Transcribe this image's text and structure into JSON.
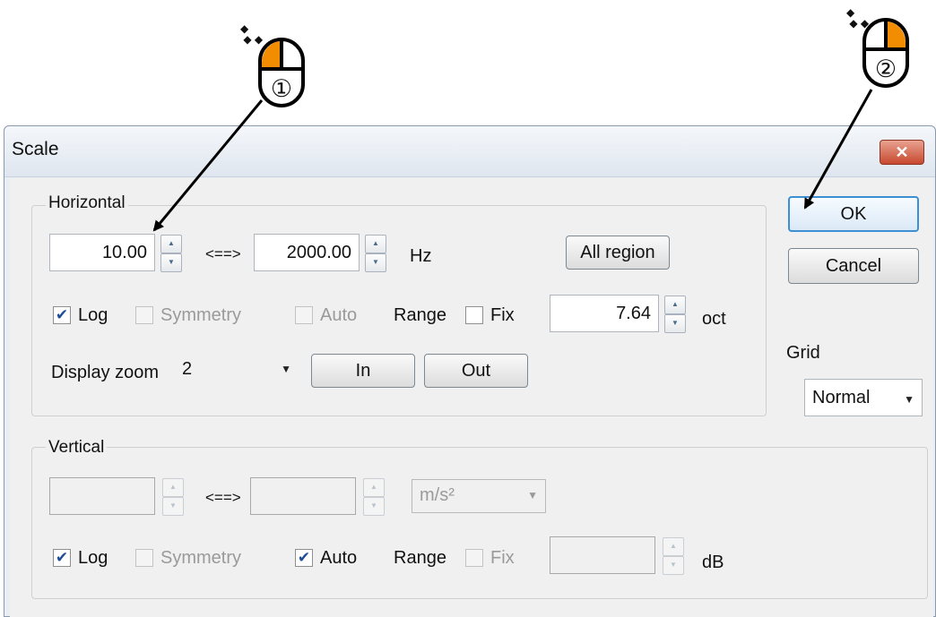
{
  "dialog": {
    "title": "Scale",
    "close_symbol": "✕"
  },
  "buttons": {
    "ok": "OK",
    "cancel": "Cancel"
  },
  "grid": {
    "label": "Grid",
    "value": "Normal"
  },
  "horizontal": {
    "label": "Horizontal",
    "from": "10.00",
    "between": "<==>",
    "to": "2000.00",
    "unit": "Hz",
    "all_region": "All region",
    "log_label": "Log",
    "log_checked": true,
    "symmetry_label": "Symmetry",
    "auto_label": "Auto",
    "range_label": "Range",
    "fix_label": "Fix",
    "range_value": "7.64",
    "range_unit": "oct",
    "zoom_label": "Display zoom",
    "zoom_value": "2",
    "in_label": "In",
    "out_label": "Out"
  },
  "vertical": {
    "label": "Vertical",
    "between": "<==>",
    "unit": "m/s²",
    "log_label": "Log",
    "log_checked": true,
    "symmetry_label": "Symmetry",
    "auto_label": "Auto",
    "auto_checked": true,
    "range_label": "Range",
    "fix_label": "Fix",
    "range_unit": "dB"
  },
  "annotations": {
    "step1": "①",
    "step2": "②"
  },
  "colors": {
    "mouse_button": "#f28c00",
    "arrow": "#000000",
    "titlebar": "#dfe6ef",
    "ok_border": "#3c8fd2"
  }
}
